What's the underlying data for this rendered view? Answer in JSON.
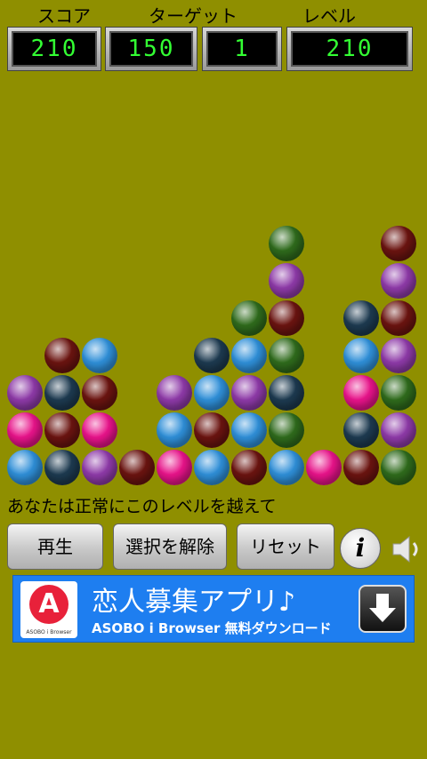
{
  "header": {
    "score_label": "スコア",
    "target_label": "ターゲット",
    "level_label": "レベル",
    "score_value": "210",
    "target_value": "150",
    "level_value": "1",
    "fourth_value": "210"
  },
  "colors": {
    "background": "#8f8f00",
    "lcd_digits": "#33ff33",
    "ball_green": "#2f6b1c",
    "ball_purple": "#8e3aa8",
    "ball_maroon": "#6b1410",
    "ball_navy": "#1d3a50",
    "ball_blue": "#2f8fd8",
    "ball_pink": "#e8138a",
    "ad_background": "#1e7ef0"
  },
  "board": {
    "columns": [
      [
        "blue",
        "pink",
        "purple"
      ],
      [
        "navy",
        "maroon",
        "navy",
        "maroon"
      ],
      [
        "purple",
        "pink",
        "maroon",
        "blue"
      ],
      [
        "maroon"
      ],
      [
        "pink",
        "blue",
        "purple"
      ],
      [
        "blue",
        "maroon",
        "blue",
        "navy"
      ],
      [
        "maroon",
        "blue",
        "purple",
        "blue",
        "green"
      ],
      [
        "blue",
        "green",
        "navy",
        "green",
        "maroon",
        "purple",
        "green"
      ],
      [
        "pink"
      ],
      [
        "maroon",
        "navy",
        "pink",
        "blue",
        "navy"
      ],
      [
        "green",
        "purple",
        "green",
        "purple",
        "maroon",
        "purple",
        "maroon"
      ]
    ]
  },
  "status_text": "あなたは正常にこのレベルを越えて",
  "buttons": {
    "play": "再生",
    "deselect": "選択を解除",
    "reset": "リセット",
    "info": "i"
  },
  "icons": {
    "info": "info-icon",
    "sound": "speaker-icon",
    "download": "download-icon"
  },
  "ad": {
    "logo_letter": "A",
    "logo_caption": "ASOBO i Browser",
    "title": "恋人募集アプリ♪",
    "subtitle": "ASOBO i Browser  無料ダウンロード"
  }
}
